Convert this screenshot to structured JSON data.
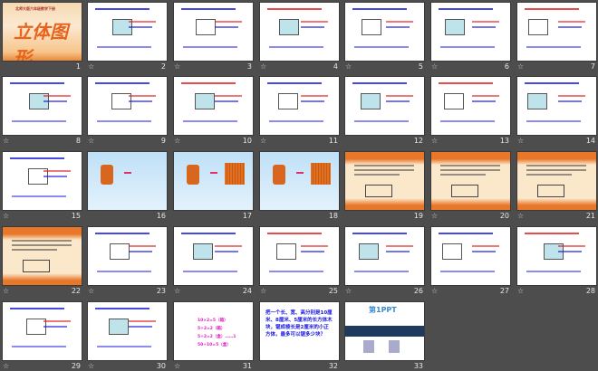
{
  "app": "PowerPoint slide sorter",
  "star_icon": "☆",
  "slides": [
    {
      "n": "1",
      "bg": "title",
      "star": false,
      "title": "立体图形",
      "subtitle": "北师大版六年级数学下册"
    },
    {
      "n": "2",
      "bg": "white",
      "star": true
    },
    {
      "n": "3",
      "bg": "white",
      "star": true
    },
    {
      "n": "4",
      "bg": "white",
      "star": true
    },
    {
      "n": "5",
      "bg": "white",
      "star": true
    },
    {
      "n": "6",
      "bg": "white",
      "star": true
    },
    {
      "n": "7",
      "bg": "white",
      "star": true
    },
    {
      "n": "8",
      "bg": "white",
      "star": true
    },
    {
      "n": "9",
      "bg": "white",
      "star": true
    },
    {
      "n": "10",
      "bg": "white",
      "star": true
    },
    {
      "n": "11",
      "bg": "white",
      "star": true
    },
    {
      "n": "12",
      "bg": "white",
      "star": false
    },
    {
      "n": "13",
      "bg": "white",
      "star": true
    },
    {
      "n": "14",
      "bg": "white",
      "star": true
    },
    {
      "n": "15",
      "bg": "white",
      "star": true
    },
    {
      "n": "16",
      "bg": "sky",
      "star": false
    },
    {
      "n": "17",
      "bg": "sky",
      "star": false
    },
    {
      "n": "18",
      "bg": "sky",
      "star": false
    },
    {
      "n": "19",
      "bg": "orange",
      "star": false
    },
    {
      "n": "20",
      "bg": "orange",
      "star": true
    },
    {
      "n": "21",
      "bg": "orange",
      "star": true
    },
    {
      "n": "22",
      "bg": "orange",
      "star": true
    },
    {
      "n": "23",
      "bg": "white",
      "star": true
    },
    {
      "n": "24",
      "bg": "white",
      "star": true
    },
    {
      "n": "25",
      "bg": "white",
      "star": true
    },
    {
      "n": "26",
      "bg": "white",
      "star": true
    },
    {
      "n": "27",
      "bg": "white",
      "star": true
    },
    {
      "n": "28",
      "bg": "white",
      "star": true
    },
    {
      "n": "29",
      "bg": "white",
      "star": true
    },
    {
      "n": "30",
      "bg": "white",
      "star": true
    },
    {
      "n": "31",
      "bg": "white",
      "star": true,
      "lines": [
        "10×2=5（箱）",
        "5÷2=2（箱）",
        "5÷2=2（盒）……1",
        "50÷10=5（盒）"
      ]
    },
    {
      "n": "32",
      "bg": "white",
      "star": false,
      "text": "把一个长、宽、高分别是10厘米、8厘米、5厘米的长方体木块，锯成棱长是2厘米的小正方体，最多可以锯多少块？"
    },
    {
      "n": "33",
      "bg": "white",
      "star": false,
      "logo": "第1PPT"
    }
  ]
}
